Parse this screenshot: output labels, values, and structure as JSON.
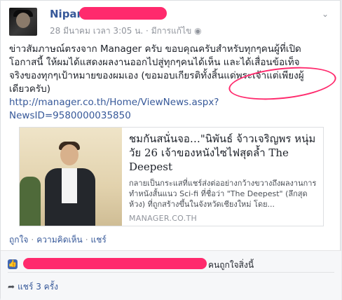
{
  "post": {
    "author": "Nipan",
    "timestamp": "28 มีนาคม เวลา 3:05 น.",
    "meta_separator": "·",
    "edited_label": "มีการแก้ไข",
    "body_lines": [
      "ข่าวสัมภาษณ์ตรงจาก Manager ครับ ขอบคุณครับสำหรับทุกๆคนผู้ที่เปิด",
      "โอกาสนี้ ให้ผมได้แสดงผลงานออกไปสู่ทุกๆคนได้เห็น และได้เสื่อนข้อเท็จ",
      "จริงของทุกๆเป้าหมายของผมเอง (ขอมอบเกียรติทั้งสิ้นแด่พระเจ้าแต่เพียงผู้",
      "เดียวครับ)"
    ],
    "link_lines": [
      "http://manager.co.th/Home/ViewNews.aspx?",
      "NewsID=9580000035850"
    ]
  },
  "preview": {
    "title": "ชมกันสนั่นจอ…\"นิพันธ์ จ้าวเจริญพร หนุ่มวัย 26 เจ้าของหนังไซไฟสุดล้ำ The Deepest",
    "description": "กลายเป็นกระแสที่แชร์ส่งต่ออย่างกว้างขวางถึงผลงานการทำหนังสั้นแนว Sci-fi ที่ชื่อว่า \"The Deepest\" (ลึกสุดห้วง) ที่ถูกสร้างขึ้นในจังหวัดเชียงใหม่ โดย...",
    "domain": "MANAGER.CO.TH"
  },
  "actions": {
    "like": "ถูกใจ",
    "comment": "ความคิดเห็น",
    "share": "แชร์",
    "separator": "·"
  },
  "footer": {
    "likes_suffix": "คนถูกใจสิ่งนี้",
    "shares_text": "แชร์ 3 ครั้ง"
  },
  "colors": {
    "link": "#365899",
    "highlight": "#ff2a6d"
  },
  "icons": {
    "menu": "chevron-down-icon",
    "like": "thumbs-up-icon",
    "share": "share-arrow-icon",
    "privacy": "globe-icon"
  }
}
